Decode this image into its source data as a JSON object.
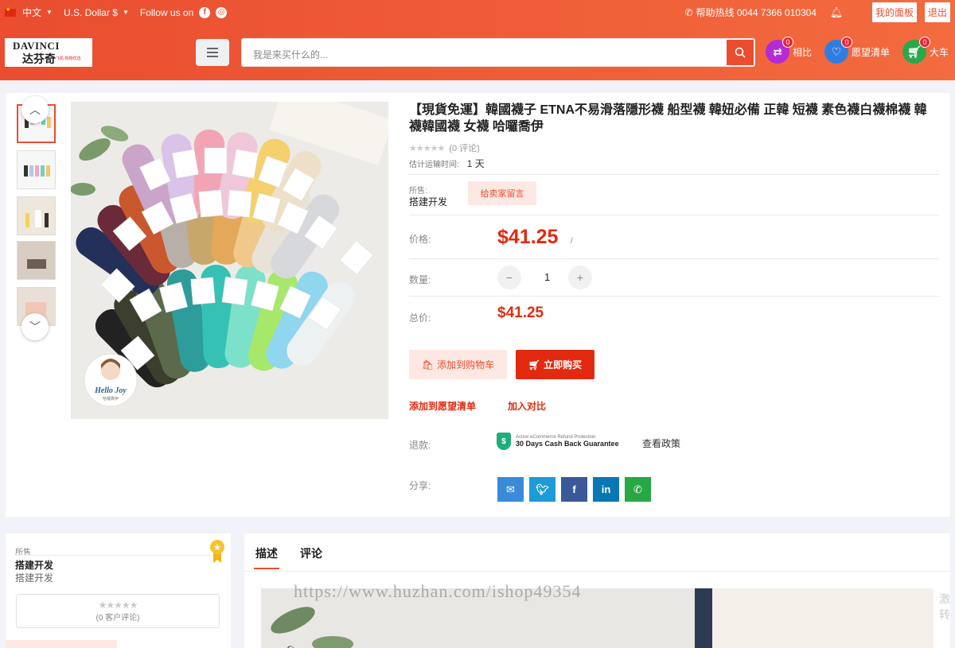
{
  "topbar": {
    "language": "中文",
    "currency": "U.S. Dollar $",
    "follow_label": "Follow us on",
    "hotline": "帮助热线 0044 7366 010304",
    "dashboard": "我的面板",
    "logout": "退出"
  },
  "header": {
    "logo_en": "DAVINCI",
    "logo_cn": "达芬奇",
    "logo_tag": "飞机·购物优选",
    "search_placeholder": "我是来买什么的...",
    "compare": {
      "label": "相比",
      "count": "0"
    },
    "wishlist": {
      "label": "愿望清单",
      "count": "0"
    },
    "cart": {
      "label": "大车",
      "count": "0"
    }
  },
  "product": {
    "title": "【現貨免運】韓國襪子 ETNA不易滑落隱形襪 船型襪 韓妞必備 正韓 短襪 素色襪白襪棉襪 韓襪韓國襪 女襪 哈囉喬伊",
    "reviews": "(0 评论)",
    "shipping_label": "估计运输时间:",
    "shipping_value": "1 天",
    "sold_by_label": "所售:",
    "seller": "搭建开发",
    "message_seller": "给卖家留言",
    "price_label": "价格:",
    "price": "$41.25",
    "price_suffix": "/",
    "qty_label": "数量:",
    "quantity": "1",
    "total_label": "总价:",
    "total": "$41.25",
    "add_to_cart": "添加到购物车",
    "buy_now": "立即购买",
    "add_wishlist": "添加到愿望清单",
    "add_compare": "加入对比",
    "refund_label": "退款:",
    "guarantee_small": "Active eCommerce Refund Protection",
    "guarantee_big": "30 Days Cash Back Guarantee",
    "view_policy": "查看政策",
    "share_label": "分享:",
    "image_sticker": "Hello Joy",
    "image_sticker_sub": "哈囉喬伊"
  },
  "seller_box": {
    "sold_by": "所售",
    "name": "搭建开发",
    "sub": "搭建开发",
    "reviews": "(0 客户评论)"
  },
  "tabs": [
    {
      "label": "描述"
    },
    {
      "label": "评论"
    }
  ],
  "watermark": "https://www.huzhan.com/ishop49354",
  "colors": {
    "brand": "#ea4d2f",
    "price": "#e22a10"
  },
  "icons": [
    "bell-icon",
    "search-icon",
    "compare-icon",
    "heart-icon",
    "cart-icon",
    "email-icon",
    "twitter-icon",
    "facebook-icon",
    "linkedin-icon",
    "whatsapp-icon"
  ]
}
